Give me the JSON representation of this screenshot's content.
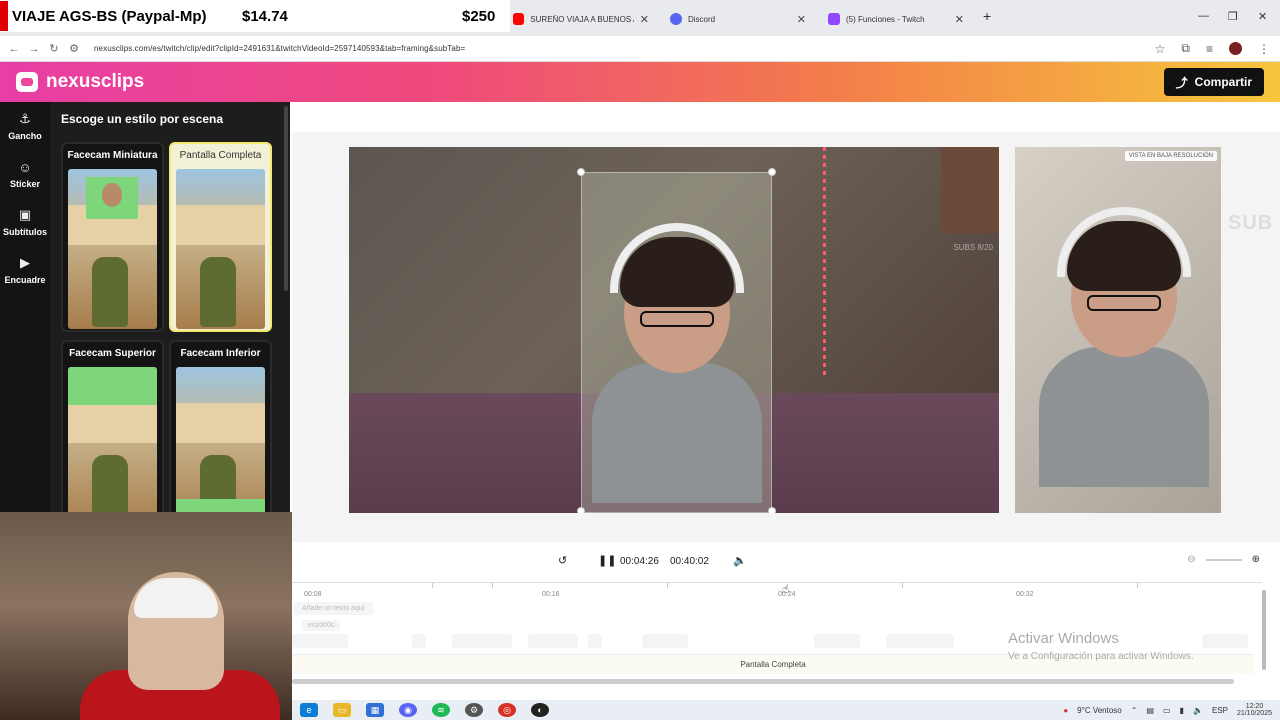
{
  "overlay": {
    "left_label": "VIAJE AGS-BS (Paypal-Mp)",
    "mid_amount": "$14.74",
    "right_amount": "$250"
  },
  "tabs": [
    {
      "title": "SUREÑO VIAJA A BUENOS AIRE",
      "color": "#ff0000"
    },
    {
      "title": "Discord",
      "color": "#5865f2"
    },
    {
      "title": "(5) Funciones - Twitch",
      "color": "#9146ff"
    }
  ],
  "address": {
    "url": "nexusclips.com/es/twitch/clip/edit?clipId=2491631&twitchVideoId=2597140593&tab=framing&subTab="
  },
  "app": {
    "brand": "nexusclips",
    "share_label": "Compartir"
  },
  "sidebar": {
    "items": [
      {
        "label": "Gancho",
        "icon": "hook-icon"
      },
      {
        "label": "Sticker",
        "icon": "sticker-icon"
      },
      {
        "label": "Subtítulos",
        "icon": "cc-icon"
      },
      {
        "label": "Encuadre",
        "icon": "video-icon"
      }
    ]
  },
  "styles": {
    "heading": "Escoge un estilo por escena",
    "options": [
      {
        "label": "Facecam Miniatura",
        "selected": false
      },
      {
        "label": "Pantalla Completa",
        "selected": true
      },
      {
        "label": "Facecam Superior",
        "selected": false
      },
      {
        "label": "Facecam Inferior",
        "selected": false
      }
    ]
  },
  "preview": {
    "subs_text": "SUBS 8/20",
    "low_res_badge": "VISTA EN BAJA RESOLUCIÓN",
    "overlay_sub": "SUB"
  },
  "timeline": {
    "current_time": "00:04:26",
    "total_time": "00:40:02",
    "ticks": [
      "00:08",
      "00:16",
      "00:24",
      "00:32"
    ],
    "track_text": "Añade un texto aquí",
    "track_user": "enzo00c",
    "scene_label": "Pantalla Completa"
  },
  "activate": {
    "line1": "Activar Windows",
    "line2": "Ve a Configuración para activar Windows."
  },
  "taskbar": {
    "weather": "9°C Ventoso",
    "lang": "ESP",
    "time": "12:20",
    "date": "21/10/2025"
  }
}
